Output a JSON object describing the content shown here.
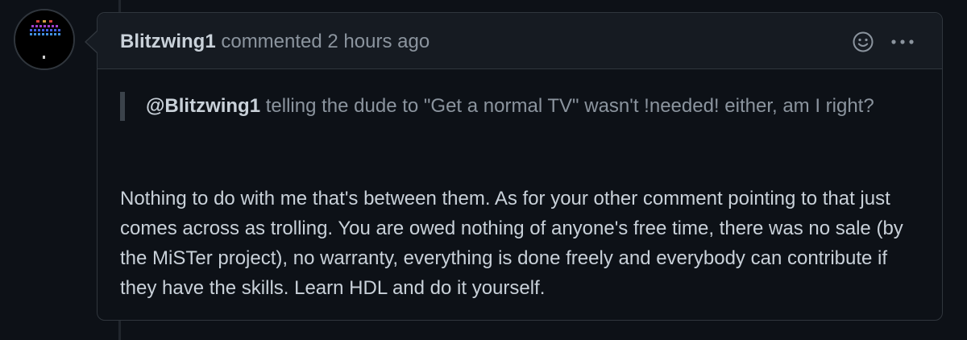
{
  "comment": {
    "author": "Blitzwing1",
    "action": "commented",
    "time": "2 hours ago",
    "quote": {
      "mention": "@Blitzwing1",
      "text": "telling the dude to \"Get a normal TV\" wasn't !needed! either, am I right?"
    },
    "body": "Nothing to do with me that's between them. As for your other comment pointing to that just comes across as trolling. You are owed nothing of anyone's free time, there was no sale (by the MiSTer project), no warranty, everything is done freely and everybody can contribute if they have the skills. Learn HDL and do it yourself."
  },
  "icons": {
    "avatar": "space-invaders-avatar",
    "reaction": "smiley-icon",
    "more": "kebab-horizontal-icon"
  },
  "colors": {
    "background": "#0d1117",
    "header_background": "#161b22",
    "border": "#30363d",
    "text_primary": "#c9d1d9",
    "text_muted": "#8b949e"
  }
}
